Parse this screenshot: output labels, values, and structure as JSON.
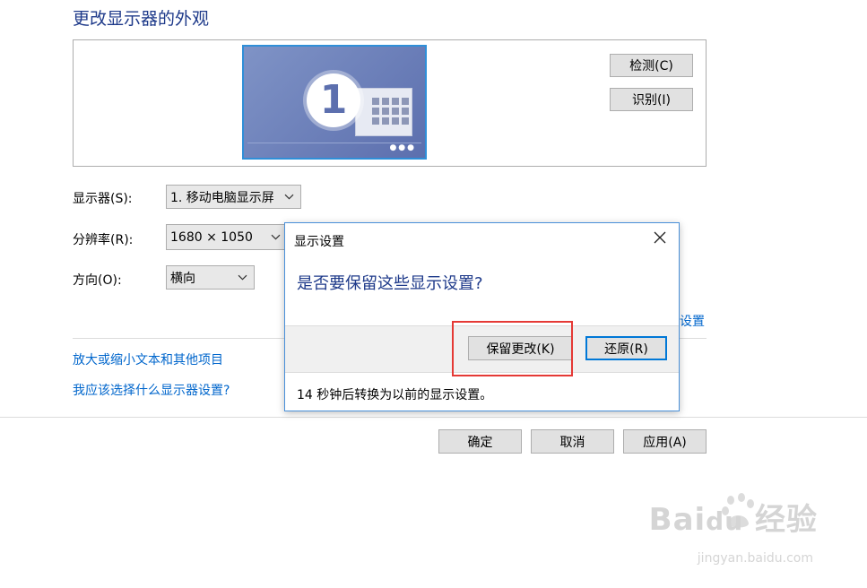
{
  "page": {
    "title": "更改显示器的外观"
  },
  "preview": {
    "monitor_number": "1",
    "detect_label": "检测(C)",
    "identify_label": "识别(I)"
  },
  "settings": {
    "display_label": "显示器(S):",
    "display_value": "1. 移动电脑显示屏",
    "resolution_label": "分辨率(R):",
    "resolution_value": "1680 × 1050",
    "orientation_label": "方向(O):",
    "orientation_value": "横向",
    "advanced_partial": "设置"
  },
  "links": {
    "text_size": "放大或缩小文本和其他项目",
    "which_settings": "我应该选择什么显示器设置?"
  },
  "bottom_buttons": {
    "ok": "确定",
    "cancel": "取消",
    "apply": "应用(A)"
  },
  "dialog": {
    "title": "显示设置",
    "question": "是否要保留这些显示设置?",
    "keep_label": "保留更改(K)",
    "revert_label": "还原(R)",
    "countdown": "14 秒钟后转换为以前的显示设置。"
  },
  "colors": {
    "accent_blue": "#0078d7",
    "highlight_red": "#e53935",
    "title_blue": "#1e3a8a",
    "link_blue": "#0066cc"
  },
  "icons": {
    "close": "close-icon",
    "chevron": "chevron-down-icon",
    "monitor": "monitor-icon"
  }
}
